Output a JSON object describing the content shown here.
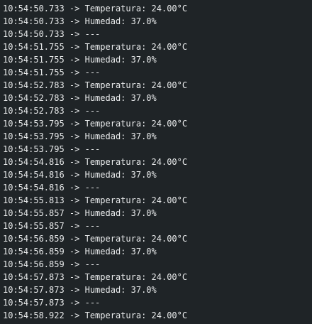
{
  "serial_monitor": {
    "lines": [
      "10:54:50.733 -> Temperatura: 24.00°C",
      "10:54:50.733 -> Humedad: 37.0%",
      "10:54:50.733 -> ---",
      "10:54:51.755 -> Temperatura: 24.00°C",
      "10:54:51.755 -> Humedad: 37.0%",
      "10:54:51.755 -> ---",
      "10:54:52.783 -> Temperatura: 24.00°C",
      "10:54:52.783 -> Humedad: 37.0%",
      "10:54:52.783 -> ---",
      "10:54:53.795 -> Temperatura: 24.00°C",
      "10:54:53.795 -> Humedad: 37.0%",
      "10:54:53.795 -> ---",
      "10:54:54.816 -> Temperatura: 24.00°C",
      "10:54:54.816 -> Humedad: 37.0%",
      "10:54:54.816 -> ---",
      "10:54:55.813 -> Temperatura: 24.00°C",
      "10:54:55.857 -> Humedad: 37.0%",
      "10:54:55.857 -> ---",
      "10:54:56.859 -> Temperatura: 24.00°C",
      "10:54:56.859 -> Humedad: 37.0%",
      "10:54:56.859 -> ---",
      "10:54:57.873 -> Temperatura: 24.00°C",
      "10:54:57.873 -> Humedad: 37.0%",
      "10:54:57.873 -> ---",
      "10:54:58.922 -> Temperatura: 24.00°C"
    ]
  },
  "colors": {
    "background": "#1f2427",
    "text": "#e8eaeb"
  }
}
